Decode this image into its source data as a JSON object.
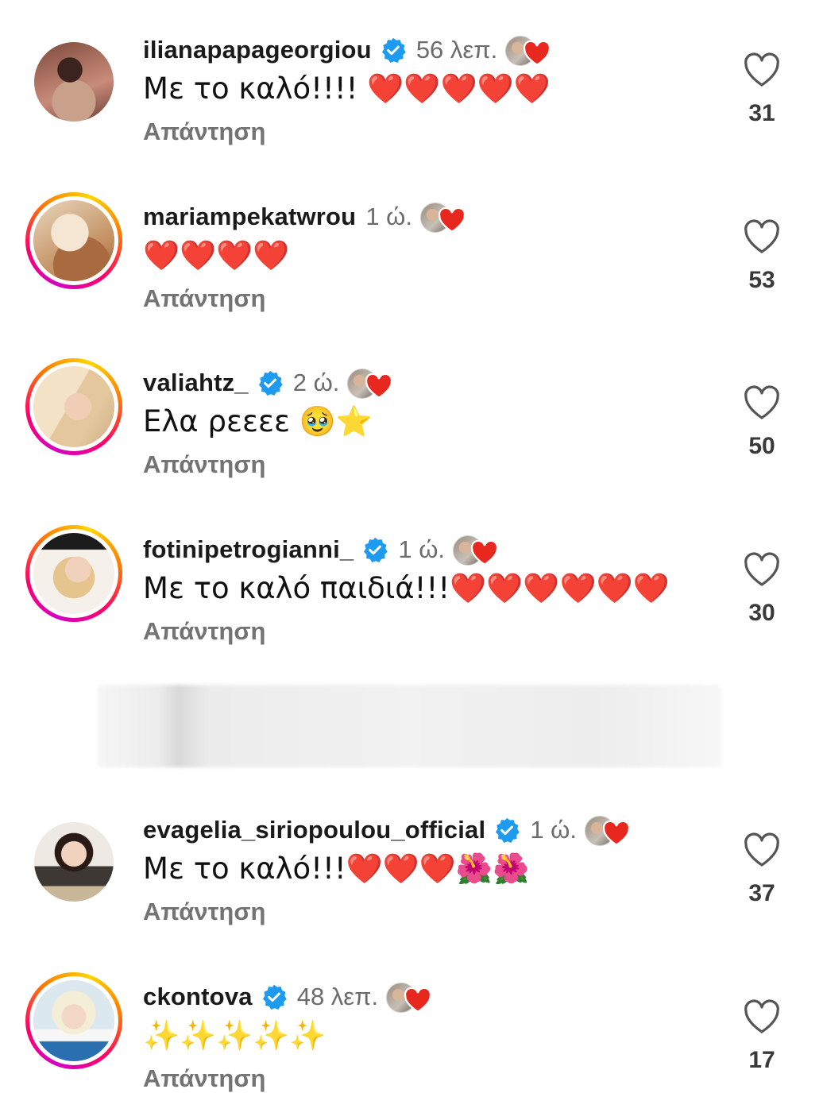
{
  "comments": [
    {
      "username": "ilianapapageorgiou",
      "verified": true,
      "time": "56 λεπ.",
      "text": "Με το καλό!!!! ❤️❤️❤️❤️❤️",
      "reply": "Απάντηση",
      "likes": "31",
      "avatar_ring": "none"
    },
    {
      "username": "mariampekatwrou",
      "verified": false,
      "time": "1 ώ.",
      "text": "❤️❤️❤️❤️",
      "reply": "Απάντηση",
      "likes": "53",
      "avatar_ring": "story"
    },
    {
      "username": "valiahtz_",
      "verified": true,
      "time": "2 ώ.",
      "text": "Ελα ρεεεε 🥹⭐",
      "reply": "Απάντηση",
      "likes": "50",
      "avatar_ring": "story"
    },
    {
      "username": "fotinipetrogianni_",
      "verified": true,
      "time": "1 ώ.",
      "text": "Με το καλό παιδιά!!!❤️❤️❤️❤️❤️❤️",
      "reply": "Απάντηση",
      "likes": "30",
      "avatar_ring": "story"
    },
    {
      "username": "evagelia_siriopoulou_official",
      "verified": true,
      "time": "1 ώ.",
      "text": "Με το καλό!!!❤️❤️❤️🌺🌺",
      "reply": "Απάντηση",
      "likes": "37",
      "avatar_ring": "none"
    },
    {
      "username": "ckontova",
      "verified": true,
      "time": "48 λεπ.",
      "text": "✨✨✨✨✨",
      "reply": "Απάντηση",
      "likes": "17",
      "avatar_ring": "story"
    }
  ],
  "icons": {
    "verified": "verified-badge-icon",
    "like": "heart-outline-icon",
    "liked_by_author": "author-liked-heart-icon"
  },
  "colors": {
    "verified_blue": "#1d9bf0",
    "heart_red": "#e8271f",
    "meta_gray": "#6b6b6b",
    "reply_gray": "#737373"
  }
}
